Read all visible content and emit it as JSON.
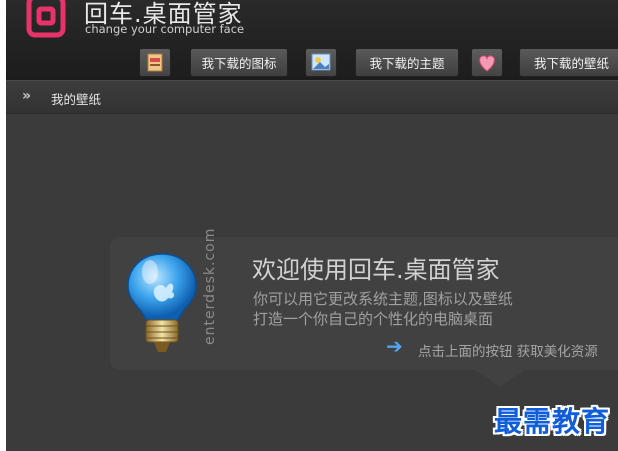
{
  "brand": {
    "title": "回车.桌面管家",
    "subtitle": "change your computer face"
  },
  "toolbar": {
    "icons_label": "我下载的图标",
    "themes_label": "我下载的主题",
    "wallpapers_label": "我下载的壁纸"
  },
  "breadcrumb": {
    "arrow": "»",
    "current": "我的壁纸"
  },
  "welcome": {
    "vertical_brand": "enterdesk.com",
    "title": "欢迎使用回车.桌面管家",
    "line1": "你可以用它更改系统主题,图标以及壁纸",
    "line2": "打造一个你自己的个性化的电脑桌面",
    "tip": "点击上面的按钮 获取美化资源"
  },
  "watermark": "最需教育",
  "colors": {
    "accent_pink": "#e8336a",
    "link_blue": "#4ea6f5",
    "background": "#3b3b3b"
  }
}
